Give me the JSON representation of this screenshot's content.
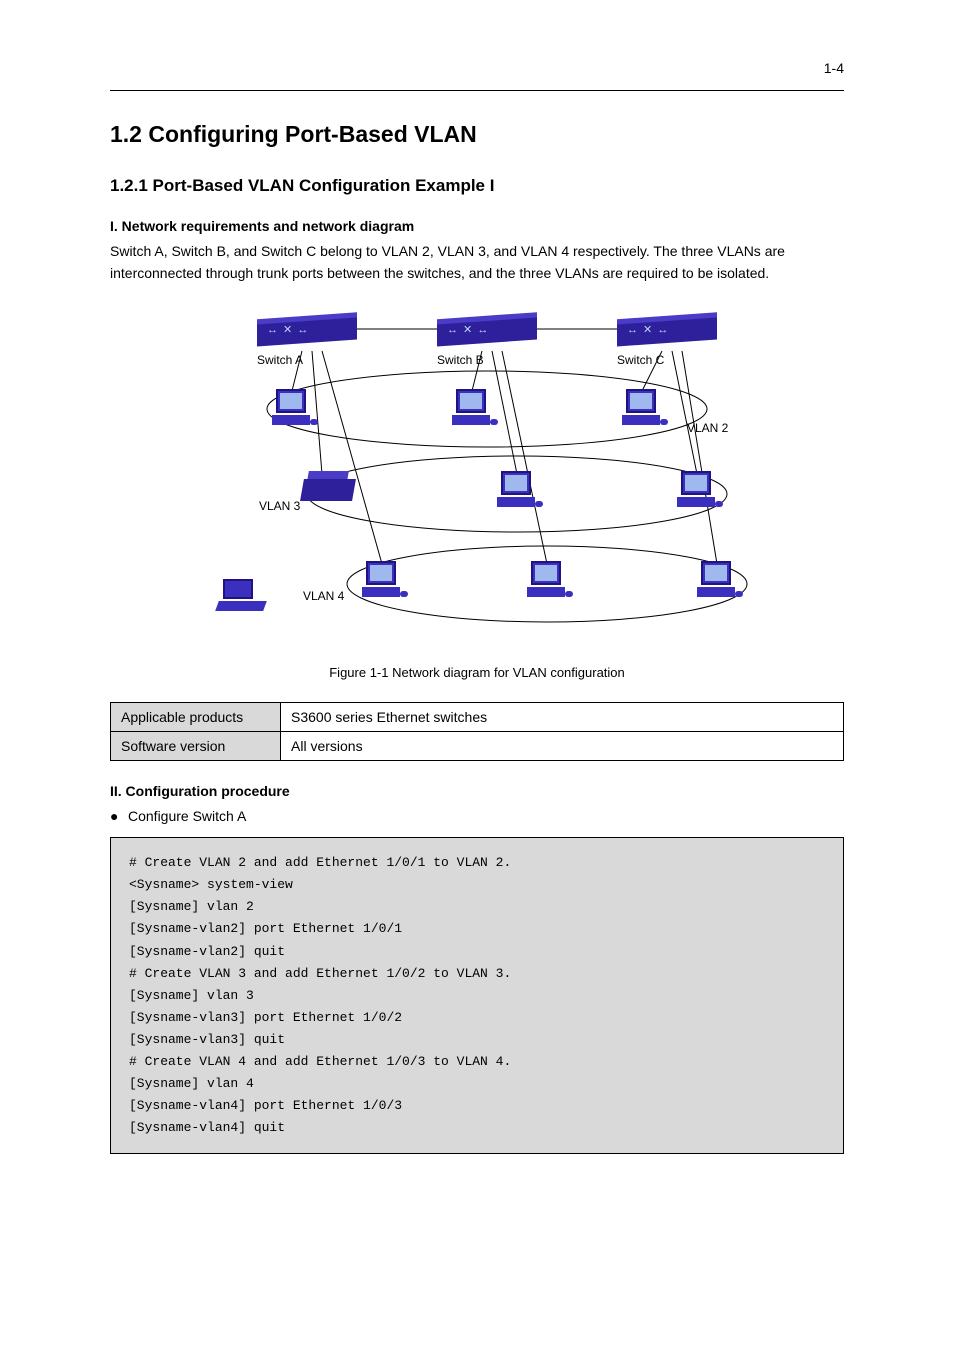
{
  "page_number": "1-4",
  "section_title": "1.2  Configuring Port-Based VLAN",
  "subsection_title": "1.2.1  Port-Based VLAN Configuration Example I",
  "topo_title": "I. Network requirements and network diagram",
  "topo_para": "Switch A, Switch B, and Switch C belong to VLAN 2, VLAN 3, and VLAN 4 respectively. The three VLANs are interconnected through trunk ports between the switches, and the three VLANs are required to be isolated.",
  "diagram": {
    "switch_a": "Switch A",
    "switch_b": "Switch B",
    "switch_c": "Switch C",
    "vlan2": "VLAN 2",
    "vlan3": "VLAN 3",
    "vlan4": "VLAN 4"
  },
  "figure_caption": "Figure 1-1 Network diagram for VLAN configuration",
  "table": {
    "row1_label": "Applicable products",
    "row1_value": "S3600 series Ethernet switches",
    "row2_label": "Software version",
    "row2_value": "All versions"
  },
  "proc_title": "II. Configuration procedure",
  "bullet": "Configure Switch A",
  "code": [
    "# Create VLAN 2 and add Ethernet 1/0/1 to VLAN 2.",
    "<Sysname> system-view",
    "[Sysname] vlan 2",
    "[Sysname-vlan2] port Ethernet 1/0/1",
    "[Sysname-vlan2] quit",
    "# Create VLAN 3 and add Ethernet 1/0/2 to VLAN 3.",
    "[Sysname] vlan 3",
    "[Sysname-vlan3] port Ethernet 1/0/2",
    "[Sysname-vlan3] quit",
    "# Create VLAN 4 and add Ethernet 1/0/3 to VLAN 4.",
    "[Sysname] vlan 4",
    "[Sysname-vlan4] port Ethernet 1/0/3",
    "[Sysname-vlan4] quit"
  ]
}
